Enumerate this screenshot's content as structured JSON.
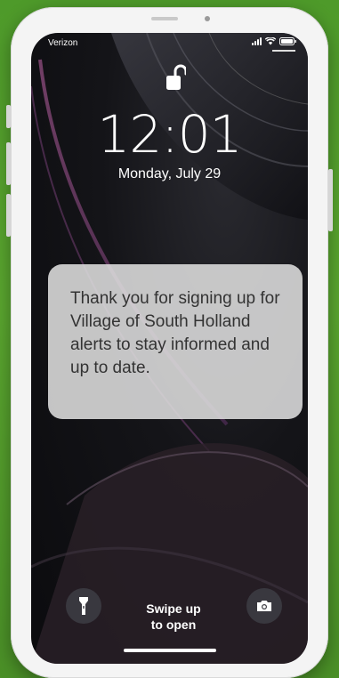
{
  "status_bar": {
    "carrier": "Verizon"
  },
  "lock_screen": {
    "time": "12:01",
    "date": "Monday, July 29",
    "lock_icon": "unlocked-padlock-icon"
  },
  "notification": {
    "message": "Thank you for signing up for Village of South Holland alerts to stay informed and up to date."
  },
  "bottom": {
    "swipe_line1": "Swipe up",
    "swipe_line2": "to open",
    "flashlight_icon": "flashlight-icon",
    "camera_icon": "camera-icon"
  },
  "colors": {
    "background_green": "#5aa62f",
    "notification_bg": "#dedede",
    "text_dark": "#333333"
  }
}
